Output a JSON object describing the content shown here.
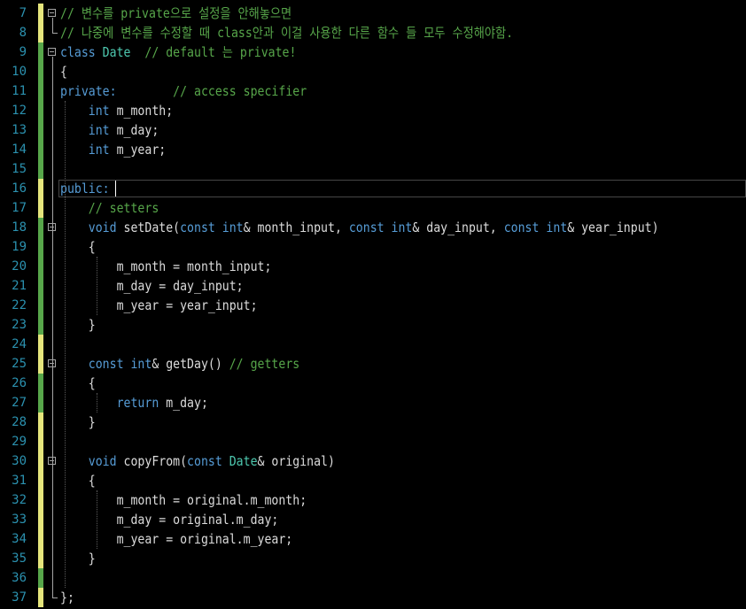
{
  "editor": {
    "colors": {
      "background": "#000000",
      "line_number": "#2b91af",
      "comment": "#57a64a",
      "keyword": "#569cd6",
      "type": "#4ec9b0",
      "identifier": "#dcdcdc",
      "changed_saved": "#57a64a",
      "changed_unsaved": "#e5e57c"
    },
    "cursor_line": 16,
    "lines": [
      {
        "n": "7",
        "change": "unsaved",
        "fold": true,
        "tokens": [
          {
            "t": "// 변수를 private으로 설정을 안해놓으면",
            "c": "comment"
          }
        ]
      },
      {
        "n": "8",
        "change": "unsaved",
        "fold": false,
        "tokens": [
          {
            "t": "// 나중에 변수를 수정할 때 class안과 이걸 사용한 다른 함수 들 모두 수정해야함.",
            "c": "comment"
          }
        ]
      },
      {
        "n": "9",
        "change": "saved",
        "fold": true,
        "tokens": [
          {
            "t": "class",
            "c": "keyword"
          },
          {
            "t": " ",
            "c": "ident"
          },
          {
            "t": "Date",
            "c": "class"
          },
          {
            "t": "  ",
            "c": "ident"
          },
          {
            "t": "// default 는 private!",
            "c": "comment"
          }
        ]
      },
      {
        "n": "10",
        "change": "saved",
        "fold": false,
        "tokens": [
          {
            "t": "{",
            "c": "ident"
          }
        ]
      },
      {
        "n": "11",
        "change": "saved",
        "fold": false,
        "tokens": [
          {
            "t": "private:",
            "c": "keyword"
          },
          {
            "t": "        ",
            "c": "ident"
          },
          {
            "t": "// access specifier",
            "c": "comment"
          }
        ]
      },
      {
        "n": "12",
        "change": "saved",
        "fold": false,
        "tokens": [
          {
            "t": "    ",
            "c": "ident"
          },
          {
            "t": "int",
            "c": "keyword"
          },
          {
            "t": " m_month;",
            "c": "ident"
          }
        ]
      },
      {
        "n": "13",
        "change": "saved",
        "fold": false,
        "tokens": [
          {
            "t": "    ",
            "c": "ident"
          },
          {
            "t": "int",
            "c": "keyword"
          },
          {
            "t": " m_day;",
            "c": "ident"
          }
        ]
      },
      {
        "n": "14",
        "change": "saved",
        "fold": false,
        "tokens": [
          {
            "t": "    ",
            "c": "ident"
          },
          {
            "t": "int",
            "c": "keyword"
          },
          {
            "t": " m_year;",
            "c": "ident"
          }
        ]
      },
      {
        "n": "15",
        "change": "saved",
        "fold": false,
        "tokens": []
      },
      {
        "n": "16",
        "change": "unsaved",
        "fold": false,
        "tokens": [
          {
            "t": "public:",
            "c": "keyword"
          }
        ]
      },
      {
        "n": "17",
        "change": "unsaved",
        "fold": false,
        "tokens": [
          {
            "t": "    ",
            "c": "ident"
          },
          {
            "t": "// setters",
            "c": "comment"
          }
        ]
      },
      {
        "n": "18",
        "change": "saved",
        "fold": true,
        "tokens": [
          {
            "t": "    ",
            "c": "ident"
          },
          {
            "t": "void",
            "c": "keyword"
          },
          {
            "t": " setDate(",
            "c": "ident"
          },
          {
            "t": "const",
            "c": "keyword"
          },
          {
            "t": " ",
            "c": "ident"
          },
          {
            "t": "int",
            "c": "keyword"
          },
          {
            "t": "& month_input, ",
            "c": "ident"
          },
          {
            "t": "const",
            "c": "keyword"
          },
          {
            "t": " ",
            "c": "ident"
          },
          {
            "t": "int",
            "c": "keyword"
          },
          {
            "t": "& day_input, ",
            "c": "ident"
          },
          {
            "t": "const",
            "c": "keyword"
          },
          {
            "t": " ",
            "c": "ident"
          },
          {
            "t": "int",
            "c": "keyword"
          },
          {
            "t": "& year_input)",
            "c": "ident"
          }
        ]
      },
      {
        "n": "19",
        "change": "saved",
        "fold": false,
        "tokens": [
          {
            "t": "    {",
            "c": "ident"
          }
        ]
      },
      {
        "n": "20",
        "change": "saved",
        "fold": false,
        "tokens": [
          {
            "t": "        m_month = month_input;",
            "c": "ident"
          }
        ]
      },
      {
        "n": "21",
        "change": "saved",
        "fold": false,
        "tokens": [
          {
            "t": "        m_day = day_input;",
            "c": "ident"
          }
        ]
      },
      {
        "n": "22",
        "change": "saved",
        "fold": false,
        "tokens": [
          {
            "t": "        m_year = year_input;",
            "c": "ident"
          }
        ]
      },
      {
        "n": "23",
        "change": "saved",
        "fold": false,
        "tokens": [
          {
            "t": "    }",
            "c": "ident"
          }
        ]
      },
      {
        "n": "24",
        "change": "unsaved",
        "fold": false,
        "tokens": []
      },
      {
        "n": "25",
        "change": "unsaved",
        "fold": true,
        "tokens": [
          {
            "t": "    ",
            "c": "ident"
          },
          {
            "t": "const",
            "c": "keyword"
          },
          {
            "t": " ",
            "c": "ident"
          },
          {
            "t": "int",
            "c": "keyword"
          },
          {
            "t": "& getDay() ",
            "c": "ident"
          },
          {
            "t": "// getters",
            "c": "comment"
          }
        ]
      },
      {
        "n": "26",
        "change": "saved",
        "fold": false,
        "tokens": [
          {
            "t": "    {",
            "c": "ident"
          }
        ]
      },
      {
        "n": "27",
        "change": "saved",
        "fold": false,
        "tokens": [
          {
            "t": "        ",
            "c": "ident"
          },
          {
            "t": "return",
            "c": "keyword"
          },
          {
            "t": " m_day;",
            "c": "ident"
          }
        ]
      },
      {
        "n": "28",
        "change": "unsaved",
        "fold": false,
        "tokens": [
          {
            "t": "    }",
            "c": "ident"
          }
        ]
      },
      {
        "n": "29",
        "change": "unsaved",
        "fold": false,
        "tokens": []
      },
      {
        "n": "30",
        "change": "unsaved",
        "fold": true,
        "tokens": [
          {
            "t": "    ",
            "c": "ident"
          },
          {
            "t": "void",
            "c": "keyword"
          },
          {
            "t": " copyFrom(",
            "c": "ident"
          },
          {
            "t": "const",
            "c": "keyword"
          },
          {
            "t": " ",
            "c": "ident"
          },
          {
            "t": "Date",
            "c": "class"
          },
          {
            "t": "& original)",
            "c": "ident"
          }
        ]
      },
      {
        "n": "31",
        "change": "unsaved",
        "fold": false,
        "tokens": [
          {
            "t": "    {",
            "c": "ident"
          }
        ]
      },
      {
        "n": "32",
        "change": "unsaved",
        "fold": false,
        "tokens": [
          {
            "t": "        m_month = original.m_month;",
            "c": "ident"
          }
        ]
      },
      {
        "n": "33",
        "change": "unsaved",
        "fold": false,
        "tokens": [
          {
            "t": "        m_day = original.m_day;",
            "c": "ident"
          }
        ]
      },
      {
        "n": "34",
        "change": "unsaved",
        "fold": false,
        "tokens": [
          {
            "t": "        m_year = original.m_year;",
            "c": "ident"
          }
        ]
      },
      {
        "n": "35",
        "change": "unsaved",
        "fold": false,
        "tokens": [
          {
            "t": "    }",
            "c": "ident"
          }
        ]
      },
      {
        "n": "36",
        "change": "saved",
        "fold": false,
        "tokens": []
      },
      {
        "n": "37",
        "change": "unsaved",
        "fold": false,
        "tokens": [
          {
            "t": "};",
            "c": "ident"
          }
        ]
      }
    ]
  }
}
